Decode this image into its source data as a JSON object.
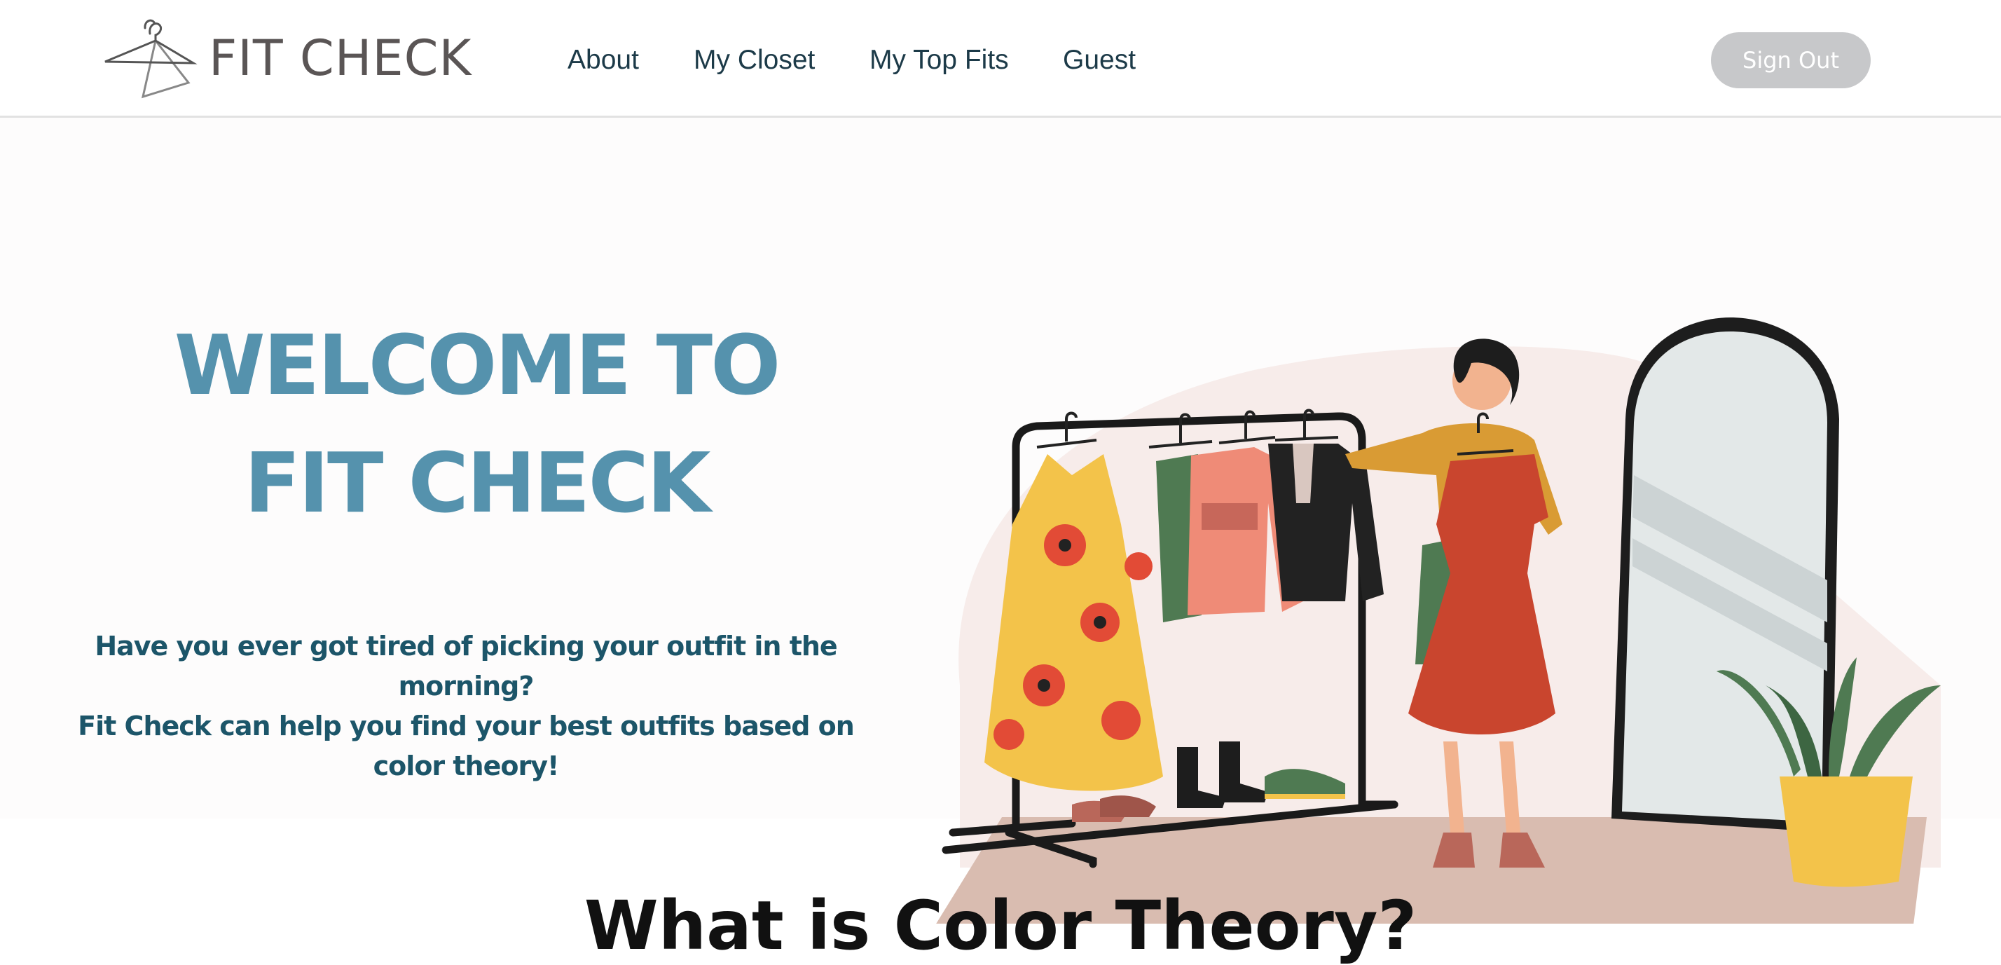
{
  "brand": {
    "name": "FIT CHECK",
    "logo_icon": "hanger-icon"
  },
  "nav": {
    "items": [
      {
        "label": "About"
      },
      {
        "label": "My Closet"
      },
      {
        "label": "My Top Fits"
      },
      {
        "label": "Guest"
      }
    ],
    "sign_out_label": "Sign Out"
  },
  "hero": {
    "title_line1": "WELCOME TO",
    "title_line2": "FIT CHECK",
    "subtitle_lines": [
      "Have you ever got tired of picking your outfit in the",
      "morning?",
      "Fit Check can help you find your best outfits based on",
      "color theory!"
    ]
  },
  "next_section": {
    "heading": "What is Color Theory?"
  },
  "colors": {
    "title": "#5592ad",
    "subtitle": "#1c5569",
    "nav_text": "#1c3a48",
    "button_bg": "#c7c8ca",
    "page_bg": "#fdfcfc"
  }
}
